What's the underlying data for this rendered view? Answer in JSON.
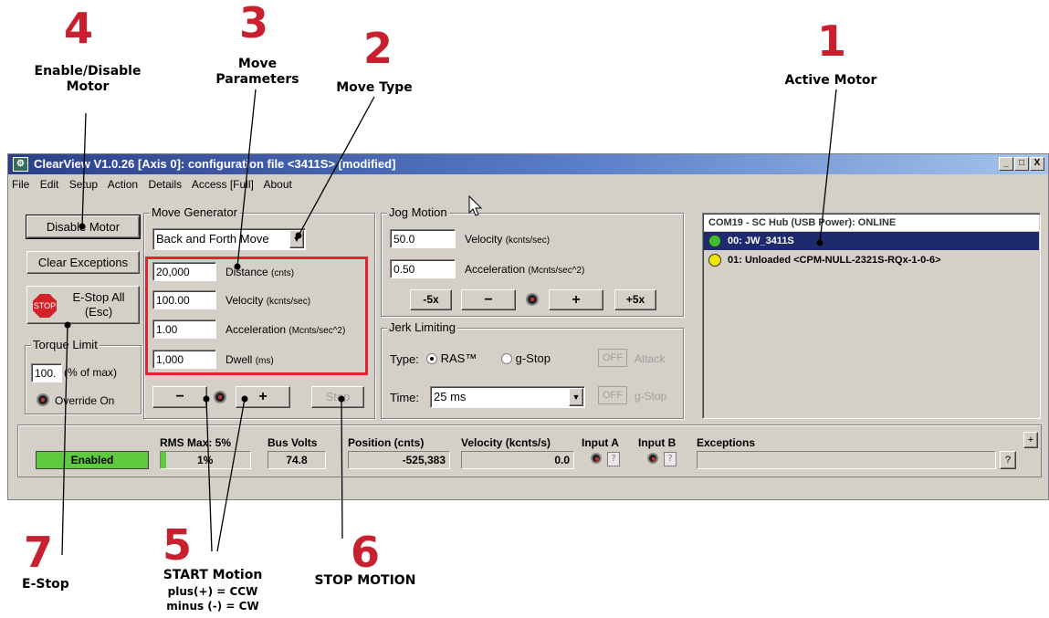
{
  "callouts": {
    "c1": {
      "num": "1",
      "label": "Active Motor"
    },
    "c2": {
      "num": "2",
      "label": "Move Type"
    },
    "c3": {
      "num": "3",
      "label1": "Move",
      "label2": "Parameters"
    },
    "c4": {
      "num": "4",
      "label1": "Enable/Disable",
      "label2": "Motor"
    },
    "c5": {
      "num": "5",
      "label": "START Motion",
      "sub1": "plus(+) = CCW",
      "sub2": "minus (-) = CW"
    },
    "c6": {
      "num": "6",
      "label": "STOP MOTION"
    },
    "c7": {
      "num": "7",
      "label": "E-Stop"
    }
  },
  "window": {
    "title": "ClearView V1.0.26 [Axis 0]:  configuration file <3411S> [modified]",
    "menu": [
      "File",
      "Edit",
      "Setup",
      "Action",
      "Details",
      "Access [Full]",
      "About"
    ],
    "controls": {
      "minimize": "_",
      "maximize": "□",
      "close": "X"
    }
  },
  "left_panel": {
    "disable_motor": "Disable Motor",
    "clear_exceptions": "Clear Exceptions",
    "estop_label": "E-Stop All",
    "estop_sub": "(Esc)",
    "stop_sign": "STOP",
    "torque_title": "Torque Limit",
    "torque_value": "100.",
    "torque_unit": "(% of max)",
    "override": "Override On"
  },
  "move_generator": {
    "title": "Move Generator",
    "move_type": "Back and Forth Move",
    "distance": {
      "value": "20,000",
      "label": "Distance",
      "unit": "(cnts)"
    },
    "velocity": {
      "value": "100.00",
      "label": "Velocity",
      "unit": "(kcnts/sec)"
    },
    "acceleration": {
      "value": "1.00",
      "label": "Acceleration",
      "unit": "(Mcnts/sec^2)"
    },
    "dwell": {
      "value": "1,000",
      "label": "Dwell",
      "unit": "(ms)"
    },
    "minus": "−",
    "plus": "+",
    "stop": "Stop"
  },
  "jog_motion": {
    "title": "Jog Motion",
    "velocity": {
      "value": "50.0",
      "label": "Velocity",
      "unit": "(kcnts/sec)"
    },
    "acceleration": {
      "value": "0.50",
      "label": "Acceleration",
      "unit": "(Mcnts/sec^2)"
    },
    "m5x": "-5x",
    "minus": "−",
    "plus": "+",
    "p5x": "+5x"
  },
  "jerk_limiting": {
    "title": "Jerk Limiting",
    "type_label": "Type:",
    "ras": "RAS™",
    "gstop": "g-Stop",
    "off1": "OFF",
    "attack": "Attack",
    "time_label": "Time:",
    "time_value": "25 ms",
    "off2": "OFF",
    "gstop2": "g-Stop"
  },
  "motor_list": {
    "header": "COM19 - SC Hub (USB Power):  ONLINE",
    "items": [
      {
        "label": "00: JW_3411S",
        "status_color": "#3fbf2f",
        "selected": true
      },
      {
        "label": "01: Unloaded <CPM-NULL-2321S-RQx-1-0-6>",
        "status_color": "#f2e600",
        "selected": false
      }
    ]
  },
  "status_bar": {
    "enabled": "Enabled",
    "rms_label": "RMS Max: 5%",
    "rms_value": "1%",
    "bus_label": "Bus Volts",
    "bus_value": "74.8",
    "pos_label": "Position (cnts)",
    "pos_value": "-525,383",
    "vel_label": "Velocity (kcnts/s)",
    "vel_value": "0.0",
    "in_a": "Input A",
    "in_b": "Input B",
    "exceptions": "Exceptions",
    "q": "?",
    "expand": "+"
  },
  "colors": {
    "callout_red": "#c8202e",
    "enabled_green": "#5ecb3e",
    "selection_blue": "#1e2a6e"
  }
}
